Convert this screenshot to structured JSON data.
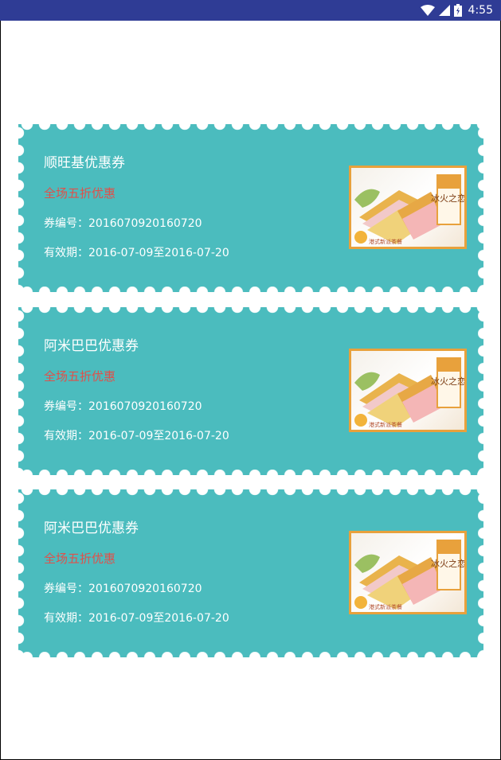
{
  "status_bar": {
    "time": "4:55",
    "icons": [
      "wifi-icon",
      "signal-icon",
      "battery-charging-icon"
    ],
    "background_color": "#2f3c95"
  },
  "colors": {
    "coupon_background": "#4bbcbe",
    "discount_text": "#e0504a",
    "image_border": "#e8a13c"
  },
  "coupons": [
    {
      "title": "顺旺基优惠券",
      "discount": "全场五折优惠",
      "code_text": "券编号：2016070920160720",
      "validity_text": "有效期：2016-07-09至2016-07-20",
      "image": {
        "brand_text": "冰火之恋",
        "watermark_text": "港式新派茶餐"
      }
    },
    {
      "title": "阿米巴巴优惠券",
      "discount": "全场五折优惠",
      "code_text": "券编号：2016070920160720",
      "validity_text": "有效期：2016-07-09至2016-07-20",
      "image": {
        "brand_text": "冰火之恋",
        "watermark_text": "港式新派茶餐"
      }
    },
    {
      "title": "阿米巴巴优惠券",
      "discount": "全场五折优惠",
      "code_text": "券编号：2016070920160720",
      "validity_text": "有效期：2016-07-09至2016-07-20",
      "image": {
        "brand_text": "冰火之恋",
        "watermark_text": "港式新派茶餐"
      }
    }
  ]
}
